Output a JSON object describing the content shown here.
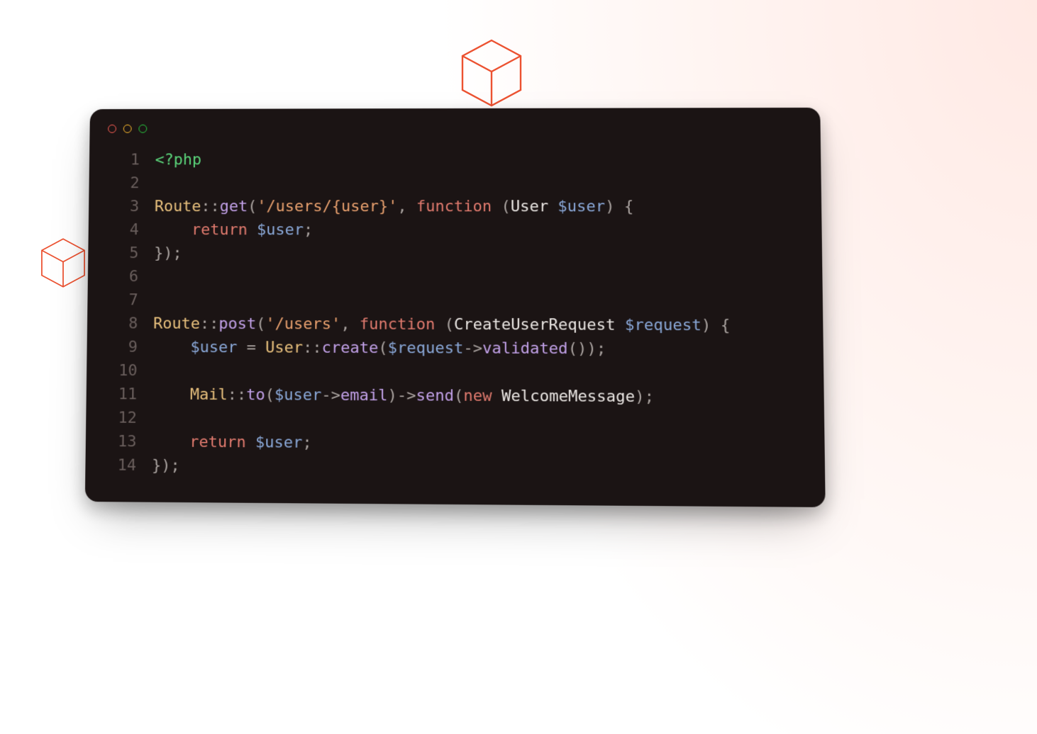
{
  "cubes": {
    "top_color": "#ec5231",
    "left_color": "#ec5231"
  },
  "code": {
    "lines": [
      {
        "n": "1",
        "tokens": [
          {
            "t": "<?php",
            "c": "c-green"
          }
        ]
      },
      {
        "n": "2",
        "tokens": []
      },
      {
        "n": "3",
        "tokens": [
          {
            "t": "Route",
            "c": "c-yellow"
          },
          {
            "t": "::",
            "c": "c-dim"
          },
          {
            "t": "get",
            "c": "c-purple"
          },
          {
            "t": "(",
            "c": "c-dim"
          },
          {
            "t": "'/users/{user}'",
            "c": "c-orange"
          },
          {
            "t": ", ",
            "c": "c-dim"
          },
          {
            "t": "function",
            "c": "c-red"
          },
          {
            "t": " (",
            "c": "c-dim"
          },
          {
            "t": "User",
            "c": "c-white"
          },
          {
            "t": " $user",
            "c": "c-blue"
          },
          {
            "t": ") {",
            "c": "c-dim"
          }
        ]
      },
      {
        "n": "4",
        "tokens": [
          {
            "t": "    ",
            "c": "c-dim"
          },
          {
            "t": "return",
            "c": "c-red"
          },
          {
            "t": " ",
            "c": "c-dim"
          },
          {
            "t": "$user",
            "c": "c-blue"
          },
          {
            "t": ";",
            "c": "c-dim"
          }
        ]
      },
      {
        "n": "5",
        "tokens": [
          {
            "t": "});",
            "c": "c-dim"
          }
        ]
      },
      {
        "n": "6",
        "tokens": []
      },
      {
        "n": "7",
        "tokens": []
      },
      {
        "n": "8",
        "tokens": [
          {
            "t": "Route",
            "c": "c-yellow"
          },
          {
            "t": "::",
            "c": "c-dim"
          },
          {
            "t": "post",
            "c": "c-purple"
          },
          {
            "t": "(",
            "c": "c-dim"
          },
          {
            "t": "'/users'",
            "c": "c-orange"
          },
          {
            "t": ", ",
            "c": "c-dim"
          },
          {
            "t": "function",
            "c": "c-red"
          },
          {
            "t": " (",
            "c": "c-dim"
          },
          {
            "t": "CreateUserRequest",
            "c": "c-white"
          },
          {
            "t": " $request",
            "c": "c-blue"
          },
          {
            "t": ") {",
            "c": "c-dim"
          }
        ]
      },
      {
        "n": "9",
        "tokens": [
          {
            "t": "    ",
            "c": "c-dim"
          },
          {
            "t": "$user",
            "c": "c-blue"
          },
          {
            "t": " = ",
            "c": "c-dim"
          },
          {
            "t": "User",
            "c": "c-yellow"
          },
          {
            "t": "::",
            "c": "c-dim"
          },
          {
            "t": "create",
            "c": "c-purple"
          },
          {
            "t": "(",
            "c": "c-dim"
          },
          {
            "t": "$request",
            "c": "c-blue"
          },
          {
            "t": "->",
            "c": "c-dim"
          },
          {
            "t": "validated",
            "c": "c-purple"
          },
          {
            "t": "());",
            "c": "c-dim"
          }
        ]
      },
      {
        "n": "10",
        "tokens": []
      },
      {
        "n": "11",
        "tokens": [
          {
            "t": "    ",
            "c": "c-dim"
          },
          {
            "t": "Mail",
            "c": "c-yellow"
          },
          {
            "t": "::",
            "c": "c-dim"
          },
          {
            "t": "to",
            "c": "c-purple"
          },
          {
            "t": "(",
            "c": "c-dim"
          },
          {
            "t": "$user",
            "c": "c-blue"
          },
          {
            "t": "->",
            "c": "c-dim"
          },
          {
            "t": "email",
            "c": "c-purple"
          },
          {
            "t": ")->",
            "c": "c-dim"
          },
          {
            "t": "send",
            "c": "c-purple"
          },
          {
            "t": "(",
            "c": "c-dim"
          },
          {
            "t": "new",
            "c": "c-red"
          },
          {
            "t": " WelcomeMessage",
            "c": "c-white"
          },
          {
            "t": ");",
            "c": "c-dim"
          }
        ]
      },
      {
        "n": "12",
        "tokens": []
      },
      {
        "n": "13",
        "tokens": [
          {
            "t": "    ",
            "c": "c-dim"
          },
          {
            "t": "return",
            "c": "c-red"
          },
          {
            "t": " ",
            "c": "c-dim"
          },
          {
            "t": "$user",
            "c": "c-blue"
          },
          {
            "t": ";",
            "c": "c-dim"
          }
        ]
      },
      {
        "n": "14",
        "tokens": [
          {
            "t": "});",
            "c": "c-dim"
          }
        ]
      }
    ]
  }
}
